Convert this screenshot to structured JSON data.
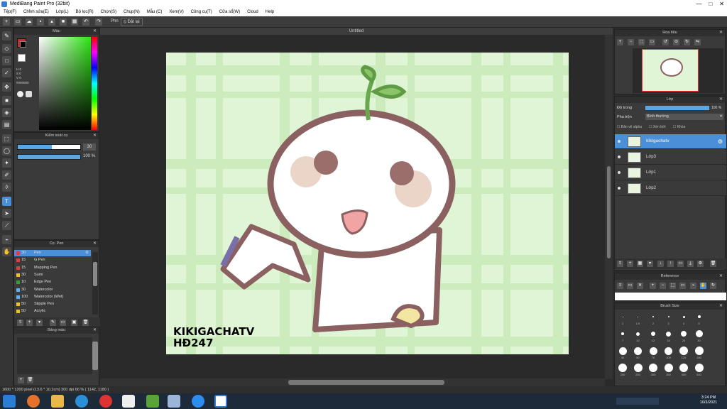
{
  "window": {
    "title": "MediBang Paint Pro (32bit)",
    "buttons": [
      "—",
      "□",
      "✕"
    ]
  },
  "menu": [
    "Tệp(F)",
    "Chỉnh sửa(E)",
    "Lớp(L)",
    "Bộ lọc(R)",
    "Chọn(S)",
    "Chụp(N)",
    "Mẫu (C)",
    "Xem(V)",
    "Công cụ(T)",
    "Cửa sổ(W)",
    "Cloud",
    "Help"
  ],
  "toolbar": {
    "phan_label": "Phn",
    "dat_lai_label": "Đặt lại"
  },
  "color_panel": {
    "title": "Màu",
    "hex": "#000000",
    "hsv": [
      "H 0",
      "S 0",
      "V 0"
    ]
  },
  "brush_panel": {
    "title": "Kiểm soát cọ",
    "size": "30",
    "opacity": "100 %",
    "size_fraction": 0.55,
    "opacity_fraction": 1.0
  },
  "pen_panel": {
    "title": "Cọ: Pen",
    "brushes": [
      {
        "n": "30",
        "name": "Pen",
        "color": "#e03c3c",
        "selected": true
      },
      {
        "n": "15",
        "name": "G Pen",
        "color": "#e03c3c"
      },
      {
        "n": "15",
        "name": "Mapping Pen",
        "color": "#e03c3c"
      },
      {
        "n": "30",
        "name": "Sumi",
        "color": "#f0c020"
      },
      {
        "n": "10",
        "name": "Edge Pen",
        "color": "#30a030"
      },
      {
        "n": "30",
        "name": "Watercolor",
        "color": "#5ab0f0"
      },
      {
        "n": "100",
        "name": "Watercolor (Wet)",
        "color": "#5ab0f0"
      },
      {
        "n": "50",
        "name": "Stipple Pen",
        "color": "#f0c020"
      },
      {
        "n": "50",
        "name": "Acrylic",
        "color": "#f0c020"
      }
    ]
  },
  "palette_panel": {
    "title": "Bảng màu"
  },
  "document": {
    "tab": "Untitled",
    "watermark": [
      "KIKIGACHATV",
      "HĐ247"
    ]
  },
  "navigator": {
    "title": "Hoa tiêu"
  },
  "layers_panel": {
    "title": "Lớp",
    "opacity_label": "Độ trong",
    "opacity": "100 %",
    "blend_label": "Pha trộn",
    "blend": "Bình thường",
    "checks": [
      "Bảo vệ alpha",
      "Xén bớt",
      "Khóa"
    ],
    "layers": [
      {
        "name": "kikigachatv",
        "selected": true
      },
      {
        "name": "Lớp3"
      },
      {
        "name": "Lớp1"
      },
      {
        "name": "Lớp2"
      }
    ]
  },
  "reference_panel": {
    "title": "Reference"
  },
  "brush_size_panel": {
    "title": "Brush Size",
    "rows": [
      [
        "1",
        "1.5",
        "2",
        "3",
        "4",
        "5"
      ],
      [
        "7",
        "10",
        "12",
        "15",
        "20",
        "30"
      ],
      [
        "40",
        "50",
        "70",
        "100",
        "120",
        "150"
      ],
      [
        "200",
        "250",
        "300",
        "350",
        "400",
        "500"
      ]
    ]
  },
  "status": {
    "text": "1600 * 1200 pixel  (13.6 * 10.2cm)  300 dpi  66 %  ( 1142, 1180 )"
  },
  "taskbar": {
    "time": "3:24 PM",
    "date": "10/3/2021"
  }
}
